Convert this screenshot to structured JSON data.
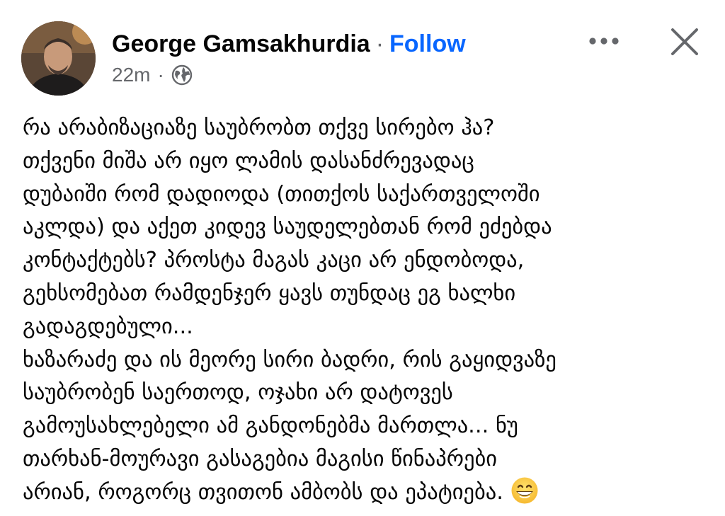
{
  "header": {
    "author_name": "George Gamsakhurdia",
    "separator": "·",
    "follow_label": "Follow",
    "time_ago": "22m",
    "meta_separator": "·",
    "audience_icon": "globe-icon",
    "more_icon": "more-options-icon",
    "close_icon": "close-icon"
  },
  "post": {
    "lines": [
      "რა არაბიზაციაზე საუბრობთ თქვე სირებო ჰა?",
      "თქვენი მიშა არ იყო ლამის დასანძრევადაც",
      "დუბაიში რომ დადიოდა (თითქოს საქართველოში",
      "აკლდა) და აქეთ კიდევ საუდელებთან რომ ეძებდა",
      "კონტაქტებს? პროსტა მაგას კაცი არ ენდობოდა,",
      "გეხსომებათ რამდენჯერ ყავს თუნდაც ეგ ხალხი",
      "გადაგდებული...",
      "ხაზარაძე და ის მეორე სირი ბადრი, რის გაყიდვაზე",
      "საუბრობენ საერთოდ, ოჯახი არ დატოვეს",
      "გამოუსახლებელი ამ განდონებმა მართლა... ნუ",
      "თარხან-მოურავი გასაგებია მაგისი წინაპრები",
      "არიან, როგორც თვითონ ამბობს და ეპატიება."
    ],
    "trailing_emoji": "grinning-face-emoji"
  }
}
